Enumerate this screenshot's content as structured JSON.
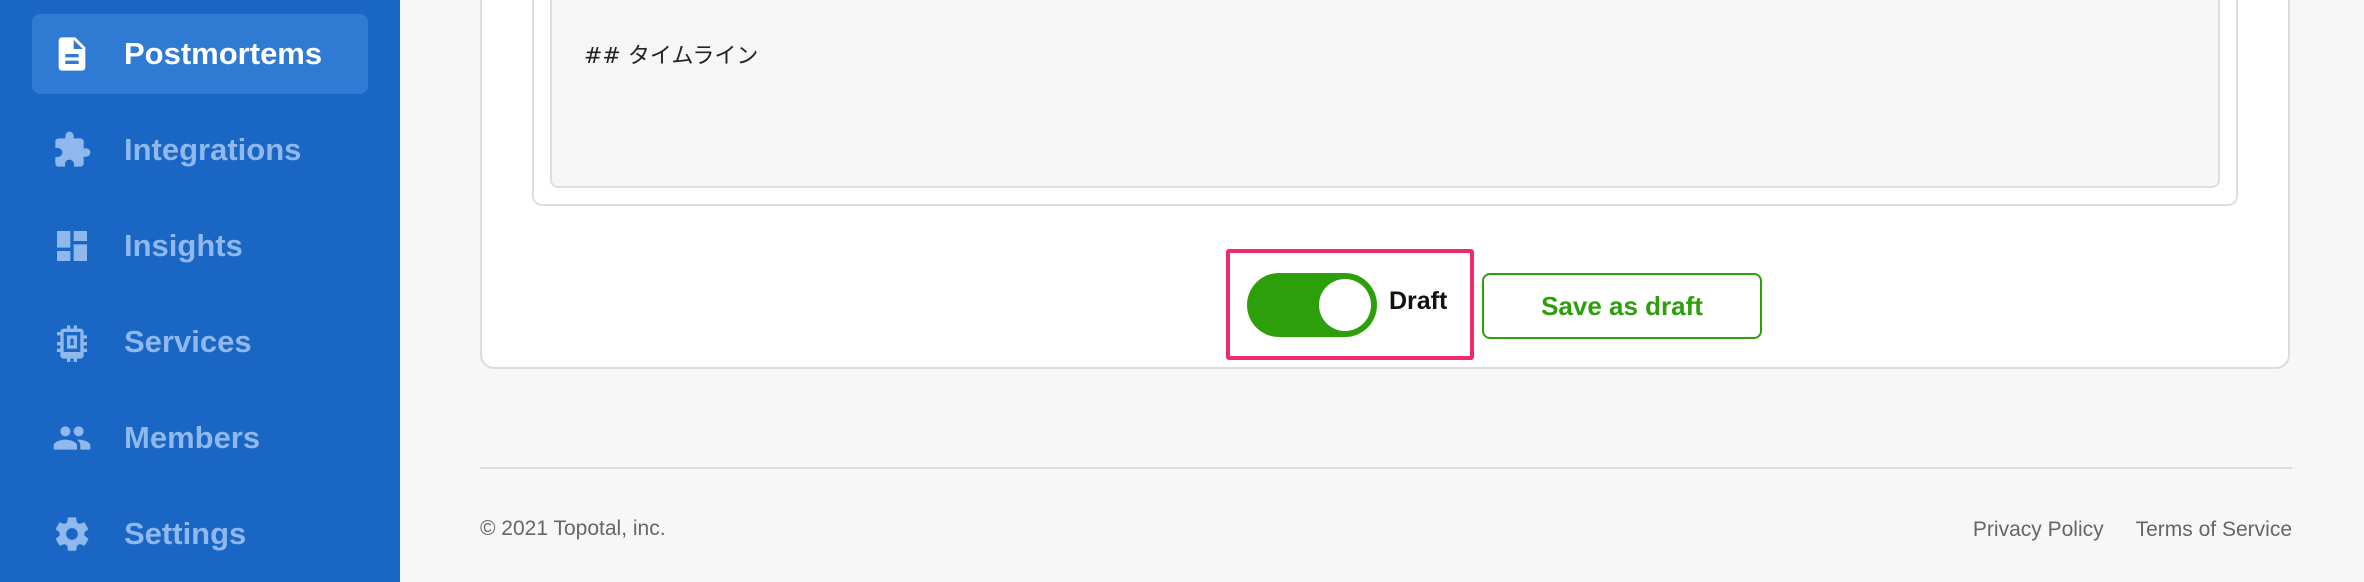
{
  "sidebar": {
    "items": [
      {
        "label": "Postmortems",
        "icon": "document-icon",
        "active": true
      },
      {
        "label": "Integrations",
        "icon": "puzzle-icon",
        "active": false
      },
      {
        "label": "Insights",
        "icon": "dashboard-icon",
        "active": false
      },
      {
        "label": "Services",
        "icon": "chip-icon",
        "active": false
      },
      {
        "label": "Members",
        "icon": "people-icon",
        "active": false
      },
      {
        "label": "Settings",
        "icon": "gear-icon",
        "active": false
      }
    ]
  },
  "editor": {
    "content": "## タイムライン"
  },
  "actions": {
    "draft_toggle_label": "Draft",
    "draft_toggle_on": true,
    "save_label": "Save as draft"
  },
  "footer": {
    "copyright": "© 2021 Topotal, inc.",
    "privacy": "Privacy Policy",
    "terms": "Terms of Service"
  },
  "colors": {
    "sidebar": "#1a66c4",
    "accent_green": "#2d9f0a",
    "highlight_pink": "#ec2a6d"
  }
}
